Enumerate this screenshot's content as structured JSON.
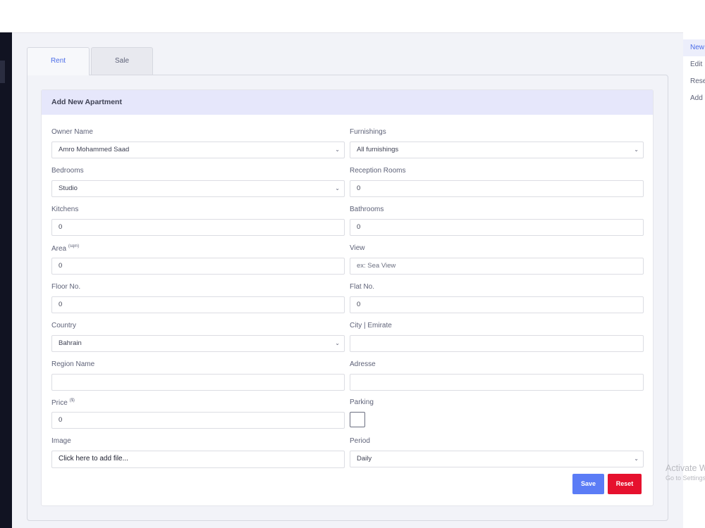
{
  "tabs": {
    "rent": "Rent",
    "sale": "Sale"
  },
  "card": {
    "title": "Add New Apartment"
  },
  "right_menu": [
    "New",
    "Edit",
    "Reset",
    "Add"
  ],
  "form": {
    "owner_name": {
      "label": "Owner Name",
      "value": "Amro Mohammed Saad"
    },
    "furnishings": {
      "label": "Furnishings",
      "value": "All furnishings"
    },
    "bedrooms": {
      "label": "Bedrooms",
      "value": "Studio"
    },
    "reception_rooms": {
      "label": "Reception Rooms",
      "value": "0"
    },
    "kitchens": {
      "label": "Kitchens",
      "value": "0"
    },
    "bathrooms": {
      "label": "Bathrooms",
      "value": "0"
    },
    "area": {
      "label": "Area",
      "unit": "(sqm)",
      "value": "0"
    },
    "view": {
      "label": "View",
      "placeholder": "ex: Sea View"
    },
    "floor_no": {
      "label": "Floor No.",
      "value": "0"
    },
    "flat_no": {
      "label": "Flat No.",
      "value": "0"
    },
    "country": {
      "label": "Country",
      "value": "Bahrain"
    },
    "city": {
      "label": "City | Emirate",
      "value": ""
    },
    "region_name": {
      "label": "Region Name",
      "value": ""
    },
    "address": {
      "label": "Adresse",
      "value": ""
    },
    "price": {
      "label": "Price",
      "unit": "($)",
      "value": "0"
    },
    "parking": {
      "label": "Parking",
      "checked": false
    },
    "image": {
      "label": "Image",
      "button": "Click here to add file..."
    },
    "period": {
      "label": "Period",
      "value": "Daily"
    }
  },
  "buttons": {
    "save": "Save",
    "reset": "Reset"
  },
  "watermark": {
    "line1": "Activate Windows",
    "line2": "Go to Settings to activate Windows."
  },
  "icons": {
    "dropdown": "chevron-down-icon"
  }
}
